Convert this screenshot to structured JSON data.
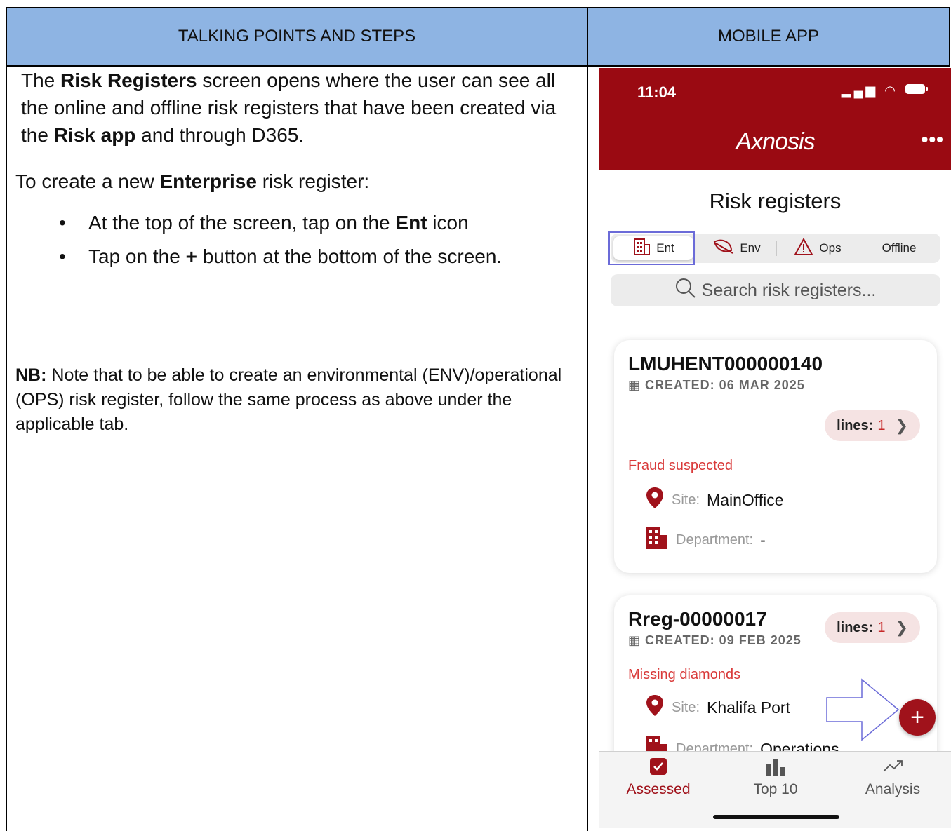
{
  "headers": {
    "left": "TALKING POINTS AND STEPS",
    "right": "MOBILE APP"
  },
  "left": {
    "p1_a": "The ",
    "p1_b": "Risk Registers",
    "p1_c": " screen opens where the user can see all the online and offline risk registers that have been created via the ",
    "p1_d": "Risk app",
    "p1_e": " and through D365.",
    "p2_a": "To create a new ",
    "p2_b": "Enterprise",
    "p2_c": " risk register:",
    "bullet1_a": "At the top of the screen, tap on the ",
    "bullet1_b": "Ent",
    "bullet1_c": " icon",
    "bullet2_a": "Tap on the ",
    "bullet2_b": "+",
    "bullet2_c": " button at the bottom of the screen.",
    "nb_label": "NB:",
    "nb_text": " Note that to be able to create an environmental (ENV)/operational (OPS) risk register, follow the same process as above under the applicable tab."
  },
  "app": {
    "time": "11:04",
    "logo": "Axnosis",
    "title": "Risk registers",
    "segments": [
      "Ent",
      "Env",
      "Ops",
      "Offline"
    ],
    "search_placeholder": "Search risk registers...",
    "cards": [
      {
        "id": "LMUHENT000000140",
        "created": "CREATED: 06 MAR 2025",
        "lines_label": "lines:",
        "lines_count": "1",
        "reason": "Fraud suspected",
        "site_label": "Site:",
        "site": "MainOffice",
        "dept_label": "Department:",
        "dept": "-"
      },
      {
        "id": "Rreg-00000017",
        "created": "CREATED: 09 FEB 2025",
        "lines_label": "lines:",
        "lines_count": "1",
        "reason": "Missing diamonds",
        "site_label": "Site:",
        "site": "Khalifa Port",
        "dept_label": "Department:",
        "dept": "Operations"
      }
    ],
    "tabs": [
      "Assessed",
      "Top 10",
      "Analysis"
    ]
  }
}
